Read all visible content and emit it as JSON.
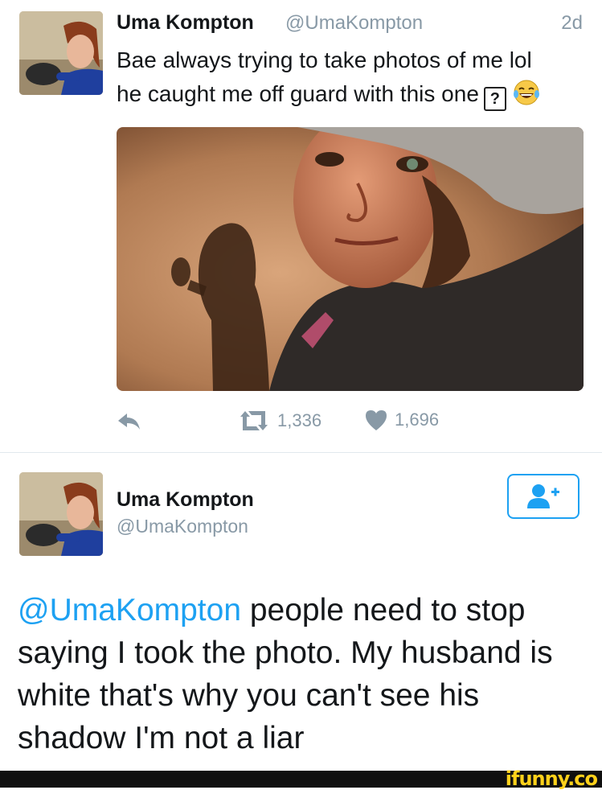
{
  "tweet": {
    "display_name": "Uma Kompton",
    "handle": "@UmaKompton",
    "timestamp": "2d",
    "text_line1": "Bae always trying to take photos of me lol",
    "text_line2": "he caught me off guard with this one",
    "unknown_glyph": "?",
    "emoji": "face-with-tears-of-joy",
    "retweet_count": "1,336",
    "like_count": "1,696"
  },
  "reply": {
    "display_name": "Uma Kompton",
    "handle": "@UmaKompton",
    "mention": "@UmaKompton",
    "text": " people need to stop saying I took the photo. My husband is white that's why you can't see his shadow I'm not a liar"
  },
  "watermark": "ifunny.co",
  "colors": {
    "accent": "#1da1f2",
    "muted": "#8899a6",
    "text": "#14171a",
    "watermark": "#ffd11a"
  },
  "icons": {
    "reply": "reply-icon",
    "retweet": "retweet-icon",
    "like": "heart-icon",
    "follow": "add-user-icon"
  }
}
